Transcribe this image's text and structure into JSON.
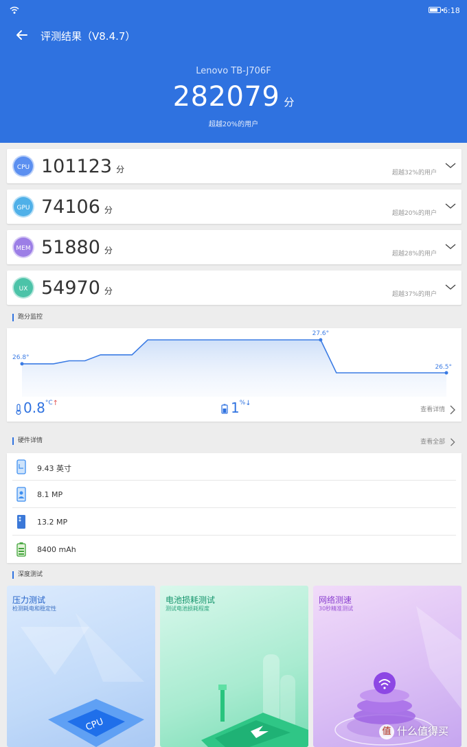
{
  "status_bar": {
    "time": "6:18"
  },
  "header": {
    "title": "评测结果（V8.4.7）",
    "device": "Lenovo TB-J706F",
    "total_score": "282079",
    "unit": "分",
    "beat_text": "超越20%的用户"
  },
  "scores": [
    {
      "badge": "CPU",
      "score": "101123",
      "unit": "分",
      "percent": "超越32%的用户",
      "color": "#5b8ff0"
    },
    {
      "badge": "GPU",
      "score": "74106",
      "unit": "分",
      "percent": "超越20%的用户",
      "color": "#4fb0e8"
    },
    {
      "badge": "MEM",
      "score": "51880",
      "unit": "分",
      "percent": "超越28%的用户",
      "color": "#9c7ee6"
    },
    {
      "badge": "UX",
      "score": "54970",
      "unit": "分",
      "percent": "超越37%的用户",
      "color": "#4cc3a8"
    }
  ],
  "monitor": {
    "section_title": "跑分监控",
    "temp_start": "26.8°",
    "temp_peak": "27.6°",
    "temp_end": "26.5°",
    "temp_delta": "0.8",
    "temp_unit": "°C",
    "temp_arrow": "↑",
    "battery_delta": "1",
    "battery_unit": "%",
    "battery_arrow": "↓",
    "detail_link": "查看详情"
  },
  "chart_data": {
    "type": "area",
    "ylabel": "",
    "xlabel": "",
    "series": [
      {
        "values": [
          26.8,
          26.8,
          26.8,
          26.9,
          26.9,
          27.1,
          27.1,
          27.1,
          27.6,
          27.6,
          27.6,
          27.6,
          27.6,
          27.6,
          27.6,
          27.6,
          27.6,
          27.6,
          27.6,
          27.6,
          26.5,
          26.5,
          26.5,
          26.5,
          26.5,
          26.5,
          26.5,
          26.5
        ]
      }
    ],
    "annotations": [
      "26.8°",
      "27.6°",
      "26.5°"
    ],
    "color": "#3a7be4"
  },
  "hardware": {
    "section_title": "硬件详情",
    "see_all": "查看全部",
    "items": [
      {
        "icon": "screen-icon",
        "text": "9.43 英寸"
      },
      {
        "icon": "front-camera-icon",
        "text": "8.1 MP"
      },
      {
        "icon": "rear-camera-icon",
        "text": "13.2 MP"
      },
      {
        "icon": "battery-icon",
        "text": "8400 mAh"
      }
    ]
  },
  "deep_test": {
    "section_title": "深度测试",
    "cards": [
      {
        "title": "压力测试",
        "subtitle": "检测耗电和稳定性",
        "chip_text": "CPU"
      },
      {
        "title": "电池损耗测试",
        "subtitle": "测试电池损耗程度"
      },
      {
        "title": "网络测速",
        "subtitle": "30秒精准测试"
      }
    ]
  },
  "watermark": {
    "icon": "值",
    "text": "什么值得买"
  }
}
